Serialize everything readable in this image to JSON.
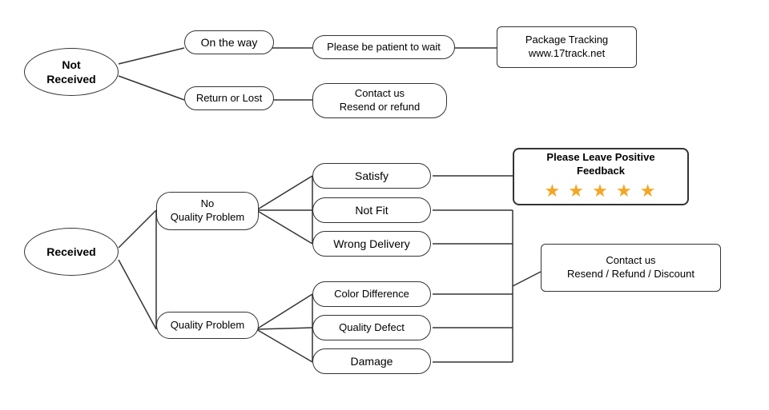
{
  "nodes": {
    "not_received": {
      "label": "Not\nReceived"
    },
    "on_the_way": {
      "label": "On the way"
    },
    "patient_wait": {
      "label": "Please be patient to wait"
    },
    "package_tracking": {
      "label": "Package Tracking\nwww.17track.net"
    },
    "return_lost": {
      "label": "Return or Lost"
    },
    "contact_resend": {
      "label": "Contact us\nResend or refund"
    },
    "received": {
      "label": "Received"
    },
    "no_quality_problem": {
      "label": "No\nQuality Problem"
    },
    "satisfy": {
      "label": "Satisfy"
    },
    "not_fit": {
      "label": "Not Fit"
    },
    "wrong_delivery": {
      "label": "Wrong Delivery"
    },
    "quality_problem": {
      "label": "Quality Problem"
    },
    "color_difference": {
      "label": "Color Difference"
    },
    "quality_defect": {
      "label": "Quality Defect"
    },
    "damage": {
      "label": "Damage"
    },
    "feedback": {
      "label": "Please Leave Positive Feedback"
    },
    "contact_refund": {
      "label": "Contact us\nResend / Refund / Discount"
    }
  },
  "stars": "★ ★ ★ ★ ★"
}
